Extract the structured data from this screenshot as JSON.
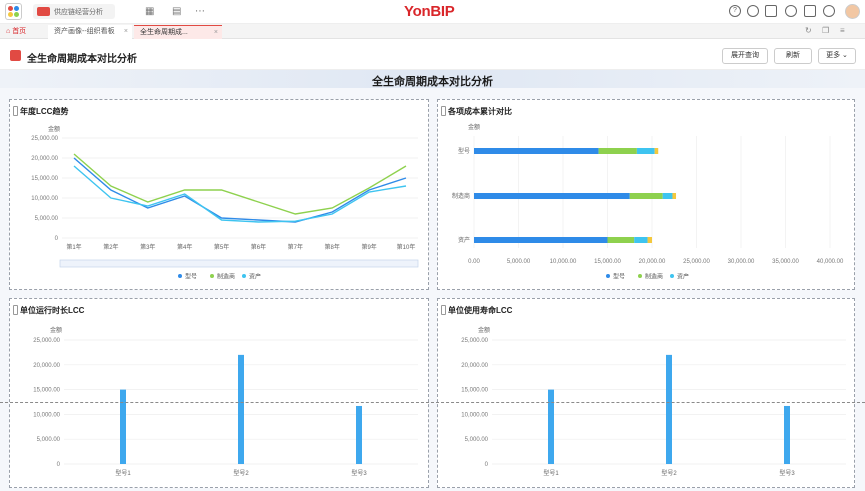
{
  "topbar": {
    "search_text": "供应链经营分析",
    "brand": "YonBIP",
    "icons": [
      "grid-icon",
      "list-icon",
      "more-icon",
      "help-icon",
      "search-icon",
      "message-icon",
      "headset-icon",
      "calendar-icon",
      "settings-icon"
    ]
  },
  "tabs": {
    "home": "首页",
    "t1": "资产画像--组织看板",
    "t2": "全生命周期成..."
  },
  "page": {
    "title": "全生命周期成本对比分析",
    "btn_query": "展开查询",
    "btn_refresh": "刷新",
    "btn_more": "更多"
  },
  "dashboard": {
    "title": "全生命周期成本对比分析"
  },
  "colors": {
    "blue": "#2f8be8",
    "green": "#8ed14e",
    "cyan": "#3ec4f0",
    "yellow": "#f4c83d",
    "brand_red": "#d9262a"
  },
  "cards": {
    "c1": {
      "title": "年度LCC趋势"
    },
    "c2": {
      "title": "各项成本累计对比"
    },
    "c3": {
      "title": "单位运行时长LCC"
    },
    "c4": {
      "title": "单位使用寿命LCC"
    }
  },
  "chart_data": [
    {
      "type": "line",
      "title": "年度LCC趋势",
      "ylabel": "金额",
      "ylim": [
        0,
        25000
      ],
      "yticks": [
        "0",
        "5,000.00",
        "10,000.00",
        "15,000.00",
        "20,000.00",
        "25,000.00"
      ],
      "categories": [
        "第1年",
        "第2年",
        "第3年",
        "第4年",
        "第5年",
        "第6年",
        "第7年",
        "第8年",
        "第9年",
        "第10年"
      ],
      "series": [
        {
          "name": "型号",
          "color": "#2f8be8",
          "values": [
            20000,
            12000,
            7500,
            10500,
            5000,
            4500,
            4000,
            6500,
            12000,
            15000
          ]
        },
        {
          "name": "制造商",
          "color": "#8ed14e",
          "values": [
            21000,
            13000,
            9000,
            12000,
            12000,
            9000,
            6000,
            7500,
            12500,
            18000
          ]
        },
        {
          "name": "资产",
          "color": "#3ec4f0",
          "values": [
            18000,
            10000,
            8000,
            11000,
            4500,
            4000,
            4200,
            6000,
            11500,
            13000
          ]
        }
      ],
      "legend": "bottom"
    },
    {
      "type": "bar",
      "orientation": "horizontal",
      "stacked": true,
      "title": "各项成本累计对比",
      "ylabel": "金额",
      "categories": [
        "型号",
        "制造商",
        "资产"
      ],
      "xlim": [
        0,
        40000
      ],
      "xticks": [
        "0.00",
        "5,000.00",
        "10,000.00",
        "15,000.00",
        "20,000.00",
        "25,000.00",
        "30,000.00",
        "35,000.00",
        "40,000.00"
      ],
      "series": [
        {
          "name": "型号",
          "color": "#2f8be8",
          "values": [
            14000,
            17500,
            15000
          ]
        },
        {
          "name": "制造商",
          "color": "#8ed14e",
          "values": [
            4300,
            3700,
            3000
          ]
        },
        {
          "name": "资产",
          "color": "#3ec4f0",
          "values": [
            2000,
            1100,
            1500
          ]
        },
        {
          "name": "",
          "color": "#f4c83d",
          "values": [
            400,
            400,
            500
          ]
        }
      ],
      "legend": "bottom"
    },
    {
      "type": "bar",
      "title": "单位运行时长LCC",
      "ylabel": "金额",
      "ylim": [
        0,
        25000
      ],
      "yticks": [
        "0",
        "5,000.00",
        "10,000.00",
        "15,000.00",
        "20,000.00",
        "25,000.00"
      ],
      "categories": [
        "型号1",
        "型号2",
        "型号3"
      ],
      "values": [
        15000,
        22000,
        11700
      ]
    },
    {
      "type": "bar",
      "title": "单位使用寿命LCC",
      "ylabel": "金额",
      "ylim": [
        0,
        25000
      ],
      "yticks": [
        "0",
        "5,000.00",
        "10,000.00",
        "15,000.00",
        "20,000.00",
        "25,000.00"
      ],
      "categories": [
        "型号1",
        "型号2",
        "型号3"
      ],
      "values": [
        15000,
        22000,
        11700
      ]
    }
  ]
}
